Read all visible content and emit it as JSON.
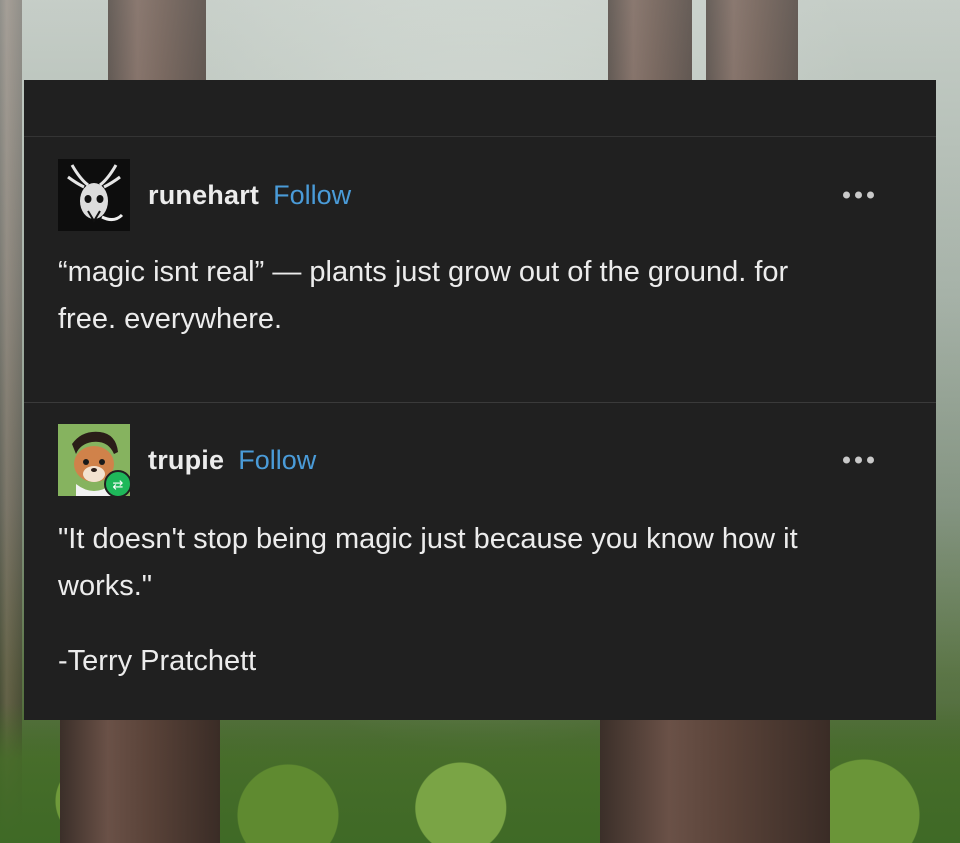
{
  "posts": [
    {
      "username": "runehart",
      "follow_label": "Follow",
      "more_icon": "ellipsis-icon",
      "body": "“magic isnt real” — plants just grow out of the ground. for free. everywhere."
    },
    {
      "username": "trupie",
      "follow_label": "Follow",
      "more_icon": "ellipsis-icon",
      "reblog_icon": "reblog-icon",
      "body": "\"It doesn't stop being magic just because you know how it works.\"",
      "signature": "-Terry Pratchett"
    }
  ],
  "colors": {
    "card_background": "#202020",
    "follow_link": "#4a9bd8",
    "text": "#ececec",
    "reblog_badge": "#1eb85a"
  }
}
